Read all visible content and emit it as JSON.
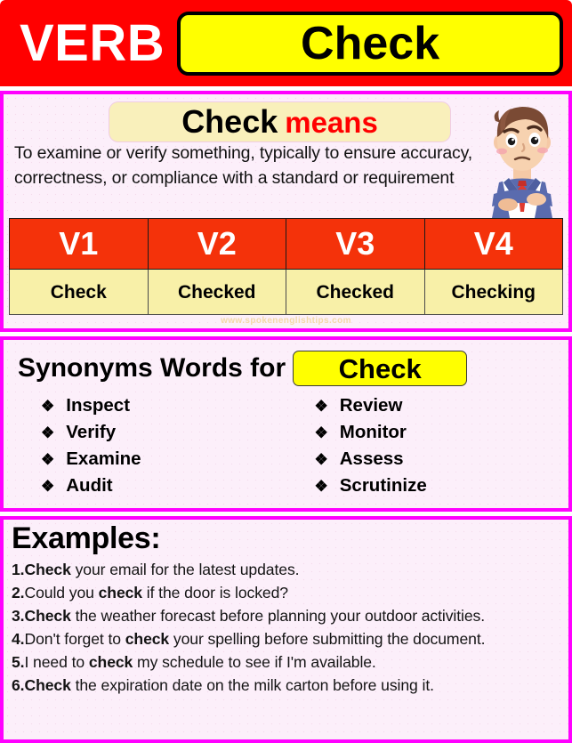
{
  "header": {
    "label": "VERB",
    "word": "Check"
  },
  "meaning": {
    "banner_word": "Check",
    "banner_suffix": "means",
    "definition": "To examine or verify something, typically to ensure accuracy, correctness, or compliance with a standard or requirement",
    "mascot": "thinking-man-illustration",
    "watermark": "www.spokenenglishtips.com"
  },
  "verb_table": {
    "headers": [
      "V1",
      "V2",
      "V3",
      "V4"
    ],
    "forms": [
      "Check",
      "Checked",
      "Checked",
      "Checking"
    ]
  },
  "synonyms": {
    "title": "Synonyms Words for",
    "chip_word": "Check",
    "bullet_glyph": "❖",
    "left_column": [
      "Inspect",
      "Verify",
      "Examine",
      "Audit"
    ],
    "right_column": [
      "Review",
      "Monitor",
      "Assess",
      "Scrutinize"
    ]
  },
  "examples": {
    "title": "Examples:",
    "items": [
      {
        "number": "1.",
        "bold_lead": "Check",
        "rest": " your email for the latest updates."
      },
      {
        "number": "2.",
        "pre": "Could you ",
        "bold_mid": "check",
        "rest": " if the door is locked?"
      },
      {
        "number": "3.",
        "bold_lead": "Check",
        "rest": " the weather forecast before planning your outdoor activities."
      },
      {
        "number": "4.",
        "pre": "Don't forget to ",
        "bold_mid": "check",
        "rest": " your spelling before submitting the document."
      },
      {
        "number": "5.",
        "pre": "I need to ",
        "bold_mid": "check",
        "rest": " my schedule to see if I'm available."
      },
      {
        "number": "6.",
        "bold_lead": "Check",
        "rest": " the expiration date on the milk carton before using it."
      }
    ]
  },
  "colors": {
    "header_red": "#FF0000",
    "chip_yellow": "#FFFF00",
    "section_border_magenta": "#FF00FF",
    "section_bg_pink": "#FCEFFA",
    "table_header_orange": "#F4320A",
    "table_cell_yellow": "#F8F0A8",
    "means_red": "#FF0000"
  }
}
